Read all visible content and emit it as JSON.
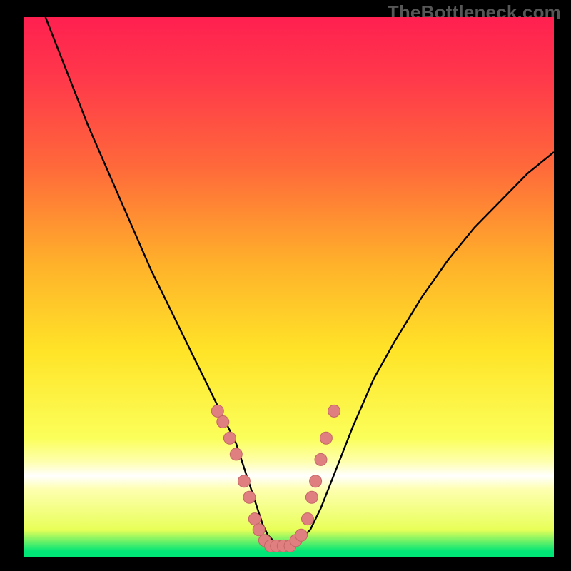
{
  "watermark": {
    "text": "TheBottleneck.com"
  },
  "colors": {
    "bg": "#000000",
    "curve": "#000000",
    "marker_fill": "#e07f7f",
    "marker_stroke": "#c46666",
    "gradient_stops": [
      {
        "offset": 0.0,
        "color": "#ff2050"
      },
      {
        "offset": 0.12,
        "color": "#ff3a4a"
      },
      {
        "offset": 0.28,
        "color": "#ff6a3a"
      },
      {
        "offset": 0.46,
        "color": "#ffb22a"
      },
      {
        "offset": 0.62,
        "color": "#ffe428"
      },
      {
        "offset": 0.78,
        "color": "#fbff5a"
      },
      {
        "offset": 0.825,
        "color": "#feffb0"
      },
      {
        "offset": 0.85,
        "color": "#ffffff"
      },
      {
        "offset": 0.875,
        "color": "#feffb0"
      },
      {
        "offset": 0.95,
        "color": "#e8ff58"
      },
      {
        "offset": 0.99,
        "color": "#00e676"
      },
      {
        "offset": 1.0,
        "color": "#00e676"
      }
    ]
  },
  "chart_data": {
    "type": "line",
    "title": "",
    "xlabel": "",
    "ylabel": "",
    "xlim": [
      0,
      100
    ],
    "ylim": [
      0,
      100
    ],
    "curve": {
      "x": [
        4,
        8,
        12,
        16,
        20,
        24,
        28,
        30,
        32,
        34,
        36,
        38,
        40,
        41,
        42,
        43,
        44,
        45,
        46,
        47,
        48,
        49,
        50,
        52,
        54,
        56,
        58,
        62,
        66,
        70,
        75,
        80,
        85,
        90,
        95,
        100
      ],
      "y": [
        100,
        90,
        80,
        71,
        62,
        53,
        45,
        41,
        37,
        33,
        29,
        25,
        21,
        18,
        15,
        12,
        9,
        6,
        4,
        3,
        2,
        2,
        2,
        3,
        5,
        9,
        14,
        24,
        33,
        40,
        48,
        55,
        61,
        66,
        71,
        75
      ]
    },
    "markers": [
      {
        "x": 36.5,
        "y": 27
      },
      {
        "x": 37.5,
        "y": 25
      },
      {
        "x": 38.8,
        "y": 22
      },
      {
        "x": 40.0,
        "y": 19
      },
      {
        "x": 41.5,
        "y": 14
      },
      {
        "x": 42.5,
        "y": 11
      },
      {
        "x": 43.5,
        "y": 7
      },
      {
        "x": 44.3,
        "y": 5
      },
      {
        "x": 45.4,
        "y": 3
      },
      {
        "x": 46.5,
        "y": 2
      },
      {
        "x": 47.6,
        "y": 2
      },
      {
        "x": 48.9,
        "y": 2
      },
      {
        "x": 50.2,
        "y": 2
      },
      {
        "x": 51.3,
        "y": 3
      },
      {
        "x": 52.3,
        "y": 4
      },
      {
        "x": 53.5,
        "y": 7
      },
      {
        "x": 54.3,
        "y": 11
      },
      {
        "x": 55.0,
        "y": 14
      },
      {
        "x": 56.0,
        "y": 18
      },
      {
        "x": 57.0,
        "y": 22
      },
      {
        "x": 58.5,
        "y": 27
      }
    ]
  }
}
